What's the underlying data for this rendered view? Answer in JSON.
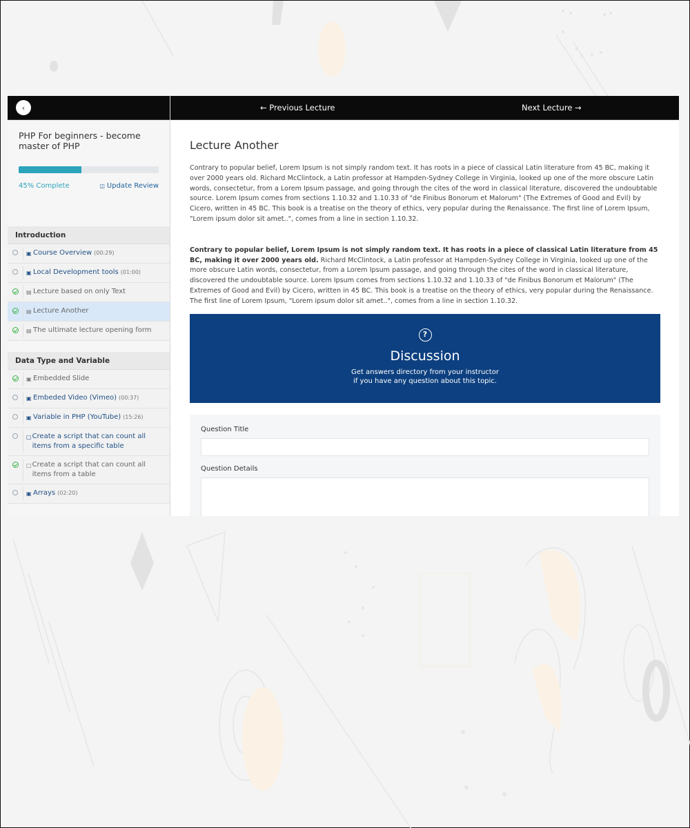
{
  "sidebar": {
    "back_icon": "chevron-left-icon",
    "course_title": "PHP For beginners - become master of PHP",
    "progress_percent": 45,
    "progress_label": "45% Complete",
    "update_review_label": "Update Review",
    "sections": [
      {
        "title": "Introduction",
        "lessons": [
          {
            "icon": "video-icon",
            "label": "Course Overview",
            "duration": "(00:29)",
            "completed": false,
            "active": false
          },
          {
            "icon": "video-icon",
            "label": "Local Development tools",
            "duration": "(01:00)",
            "completed": false,
            "active": false
          },
          {
            "icon": "document-icon",
            "label": "Lecture based on only Text",
            "duration": "",
            "completed": true,
            "active": false
          },
          {
            "icon": "document-icon",
            "label": "Lecture Another",
            "duration": "",
            "completed": true,
            "active": true
          },
          {
            "icon": "document-icon",
            "label": "The ultimate lecture opening form",
            "duration": "",
            "completed": true,
            "active": false
          }
        ]
      },
      {
        "title": "Data Type and Variable",
        "lessons": [
          {
            "icon": "video-icon",
            "label": "Embedded Slide",
            "duration": "",
            "completed": true,
            "active": false
          },
          {
            "icon": "video-icon",
            "label": "Embeded Video (Vimeo)",
            "duration": "(00:37)",
            "completed": false,
            "active": false
          },
          {
            "icon": "video-icon",
            "label": "Variable in PHP (YouTube)",
            "duration": "(15:26)",
            "completed": false,
            "active": false
          },
          {
            "icon": "quiz-icon",
            "label": "Create a script that can count all items from a specific table",
            "duration": "",
            "completed": false,
            "active": false
          },
          {
            "icon": "quiz-icon",
            "label": "Create a script that can count all items from a table",
            "duration": "",
            "completed": true,
            "active": false
          },
          {
            "icon": "video-icon",
            "label": "Arrays",
            "duration": "(02:20)",
            "completed": false,
            "active": false
          }
        ]
      }
    ]
  },
  "topbar": {
    "prev_label": "← Previous Lecture",
    "next_label": "Next Lecture →"
  },
  "lecture": {
    "title": "Lecture Another",
    "paragraph1": "Contrary to popular belief, Lorem Ipsum is not simply random text. It has roots in a piece of classical Latin literature from 45 BC, making it over 2000 years old. Richard McClintock, a Latin professor at Hampden-Sydney College in Virginia, looked up one of the more obscure Latin words, consectetur, from a Lorem Ipsum passage, and going through the cites of the word in classical literature, discovered the undoubtable source. Lorem Ipsum comes from sections 1.10.32 and 1.10.33 of \"de Finibus Bonorum et Malorum\" (The Extremes of Good and Evil) by Cicero, written in 45 BC. This book is a treatise on the theory of ethics, very popular during the Renaissance. The first line of Lorem Ipsum, \"Lorem ipsum dolor sit amet..\", comes from a line in section 1.10.32.",
    "paragraph2_bold": "Contrary to popular belief, Lorem Ipsum is not simply random text. It has roots in a piece of classical Latin literature from 45 BC, making it over 2000 years old.",
    "paragraph2_rest": " Richard McClintock, a Latin professor at Hampden-Sydney College in Virginia, looked up one of the more obscure Latin words, consectetur, from a Lorem Ipsum passage, and going through the cites of the word in classical literature, discovered the undoubtable source. Lorem Ipsum comes from sections 1.10.32 and 1.10.33 of \"de Finibus Bonorum et Malorum\" (The Extremes of Good and Evil) by Cicero, written in 45 BC. This book is a treatise on the theory of ethics, very popular during the Renaissance. The first line of Lorem Ipsum, \"Lorem ipsum dolor sit amet..\", comes from a line in section 1.10.32."
  },
  "discussion": {
    "icon": "question-circle-icon",
    "icon_glyph": "?",
    "title": "Discussion",
    "subtitle_line1": "Get answers directory from your instructor",
    "subtitle_line2": "if you have any question about this topic."
  },
  "question_form": {
    "title_label": "Question Title",
    "title_value": "",
    "details_label": "Question Details",
    "details_value": ""
  },
  "colors": {
    "accent": "#2ba3bb",
    "discussion_bg": "#0d4080",
    "link": "#1f4f85",
    "completed": "#3bb34a",
    "active_row": "#d8e8f8"
  }
}
